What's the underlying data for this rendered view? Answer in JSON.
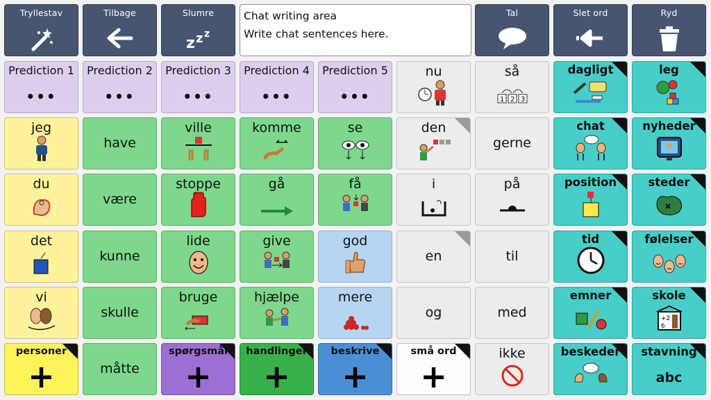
{
  "toolbar": {
    "magic": "Tryllestav",
    "back": "Tilbage",
    "sleep": "Slumre",
    "speak": "Tal",
    "delete_word": "Slet ord",
    "clear": "Ryd"
  },
  "chat": {
    "title": "Chat writing area",
    "placeholder": "Write chat sentences here."
  },
  "predictions": [
    "Prediction 1",
    "Prediction 2",
    "Prediction 3",
    "Prediction 4",
    "Prediction 5"
  ],
  "predictions_dots": "•••",
  "words": {
    "nu": "nu",
    "saa": "så",
    "jeg": "jeg",
    "have": "have",
    "ville": "ville",
    "komme": "komme",
    "se": "se",
    "den": "den",
    "gerne": "gerne",
    "du": "du",
    "vaere": "være",
    "stoppe": "stoppe",
    "gaa": "gå",
    "faa": "få",
    "i": "i",
    "paa": "på",
    "det": "det",
    "kunne": "kunne",
    "lide": "lide",
    "give": "give",
    "god": "god",
    "en": "en",
    "til": "til",
    "vi": "vi",
    "skulle": "skulle",
    "bruge": "bruge",
    "hjaelpe": "hjælpe",
    "mere": "mere",
    "og": "og",
    "med": "med",
    "maatte": "måtte",
    "ikke": "ikke"
  },
  "categories": {
    "dagligt": "dagligt",
    "leg": "leg",
    "chat": "chat",
    "nyheder": "nyheder",
    "position": "position",
    "steder": "steder",
    "tid": "tid",
    "foelelser": "følelser",
    "emner": "emner",
    "skole": "skole",
    "beskeder": "beskeder",
    "stavning": "stavning",
    "personer": "personer",
    "spoergsmaal": "spørgsmål",
    "handlinger": "handlinger",
    "beskrive": "beskrive",
    "smaa_ord": "små ord"
  },
  "plus": "+",
  "abc": "abc",
  "colors": {
    "toolbar": "#475670",
    "prediction": "#dccfee",
    "pronoun": "#fff49b",
    "verb": "#7dd88c",
    "adjective": "#b6d5f3",
    "function": "#ececec",
    "category": "#47cec8"
  }
}
